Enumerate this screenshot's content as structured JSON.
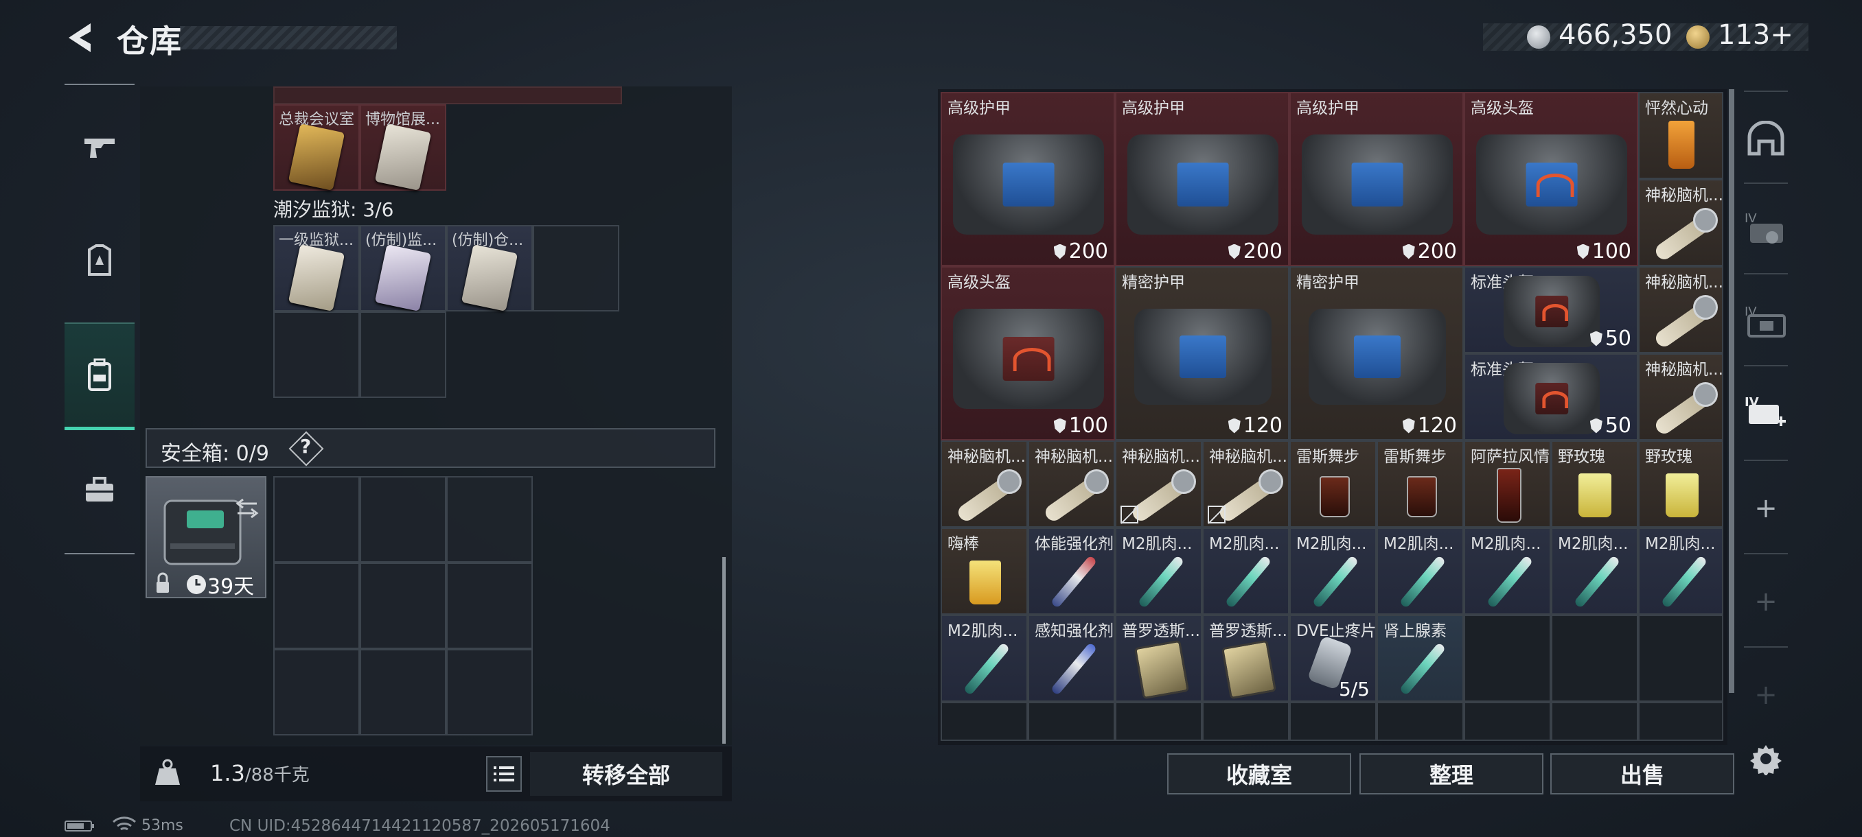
{
  "header": {
    "title": "仓库"
  },
  "currency": {
    "coin1": "466,350",
    "coin2": "113+"
  },
  "left": {
    "top_items": [
      {
        "label": "总裁会议室"
      },
      {
        "label": "博物馆展..."
      }
    ],
    "prison_label": "潮汐监狱: 3/6",
    "prison_items": [
      {
        "label": "一级监狱..."
      },
      {
        "label": "(仿制)监..."
      },
      {
        "label": "(仿制)仓..."
      }
    ],
    "safebox_label": "安全箱: 0/9",
    "help_label": "?",
    "safebox_days": "39天",
    "weight_value": "1.3",
    "weight_cap": "/88千克",
    "transfer_label": "转移全部"
  },
  "status": {
    "ping": "53ms",
    "uid": "CN UID:4528644714421120587_202605171604"
  },
  "right": {
    "items": [
      {
        "label": "高级护甲",
        "durability": "200"
      },
      {
        "label": "高级护甲",
        "durability": "200"
      },
      {
        "label": "高级护甲",
        "durability": "200"
      },
      {
        "label": "高级头盔",
        "durability": "100"
      },
      {
        "label": "怦然心动"
      },
      {
        "label": "神秘脑机..."
      },
      {
        "label": "高级头盔",
        "durability": "100"
      },
      {
        "label": "精密护甲",
        "durability": "120"
      },
      {
        "label": "精密护甲",
        "durability": "120"
      },
      {
        "label": "标准头盔",
        "durability": "50"
      },
      {
        "label": "神秘脑机..."
      },
      {
        "label": "标准头盔",
        "durability": "50"
      },
      {
        "label": "神秘脑机..."
      },
      {
        "label": "神秘脑机..."
      },
      {
        "label": "神秘脑机..."
      },
      {
        "label": "神秘脑机..."
      },
      {
        "label": "神秘脑机..."
      },
      {
        "label": "雷斯舞步"
      },
      {
        "label": "雷斯舞步"
      },
      {
        "label": "阿萨拉风情"
      },
      {
        "label": "野玫瑰"
      },
      {
        "label": "野玫瑰"
      },
      {
        "label": "嗨棒"
      },
      {
        "label": "体能强化剂"
      },
      {
        "label": "M2肌肉..."
      },
      {
        "label": "M2肌肉..."
      },
      {
        "label": "M2肌肉..."
      },
      {
        "label": "M2肌肉..."
      },
      {
        "label": "M2肌肉..."
      },
      {
        "label": "M2肌肉..."
      },
      {
        "label": "M2肌肉..."
      },
      {
        "label": "M2肌肉..."
      },
      {
        "label": "感知强化剂"
      },
      {
        "label": "普罗透斯..."
      },
      {
        "label": "普罗透斯..."
      },
      {
        "label": "DVE止疼片",
        "stack": "5/5"
      },
      {
        "label": "肾上腺素"
      }
    ],
    "buttons": {
      "collect": "收藏室",
      "sort": "整理",
      "sell": "出售"
    }
  },
  "colors": {
    "accent": "#45d3b0",
    "item_red": "#4a2329",
    "item_brown": "#3b332d",
    "item_blue": "#2b3142"
  },
  "icons": [
    "back-arrow-icon",
    "weapon-icon",
    "armor-icon",
    "backpack-icon",
    "toolbox-icon",
    "weight-icon",
    "list-icon",
    "helmet-slot-icon",
    "gear-icon"
  ]
}
